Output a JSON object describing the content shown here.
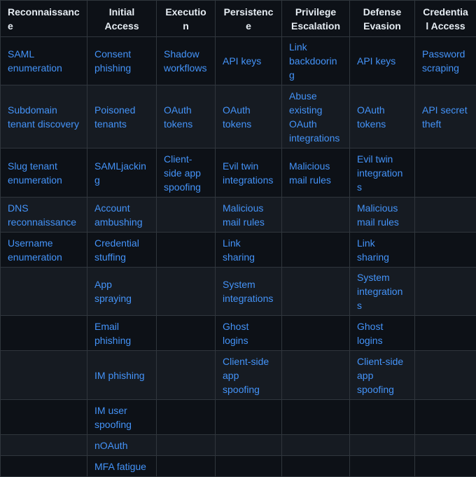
{
  "headers": [
    "Reconnaissance",
    "Initial Access",
    "Execution",
    "Persistence",
    "Privilege Escalation",
    "Defense Evasion",
    "Credential Access"
  ],
  "rows": [
    [
      "SAML enumeration",
      "Consent phishing",
      "Shadow workflows",
      "API keys",
      "Link backdooring",
      "API keys",
      "Password scraping"
    ],
    [
      "Subdomain tenant discovery",
      "Poisoned tenants",
      "OAuth tokens",
      "OAuth tokens",
      "Abuse existing OAuth integrations",
      "OAuth tokens",
      "API secret theft"
    ],
    [
      "Slug tenant enumeration",
      "SAMLjacking",
      "Client-side app spoofing",
      "Evil twin integrations",
      "Malicious mail rules",
      "Evil twin integrations",
      ""
    ],
    [
      "DNS reconnaissance",
      "Account ambushing",
      "",
      "Malicious mail rules",
      "",
      "Malicious mail rules",
      ""
    ],
    [
      "Username enumeration",
      "Credential stuffing",
      "",
      "Link sharing",
      "",
      "Link sharing",
      ""
    ],
    [
      "",
      "App spraying",
      "",
      "System integrations",
      "",
      "System integrations",
      ""
    ],
    [
      "",
      "Email phishing",
      "",
      "Ghost logins",
      "",
      "Ghost logins",
      ""
    ],
    [
      "",
      "IM phishing",
      "",
      "Client-side app spoofing",
      "",
      "Client-side app spoofing",
      ""
    ],
    [
      "",
      "IM user spoofing",
      "",
      "",
      "",
      "",
      ""
    ],
    [
      "",
      "nOAuth",
      "",
      "",
      "",
      "",
      ""
    ],
    [
      "",
      "MFA fatigue",
      "",
      "",
      "",
      "",
      ""
    ]
  ]
}
